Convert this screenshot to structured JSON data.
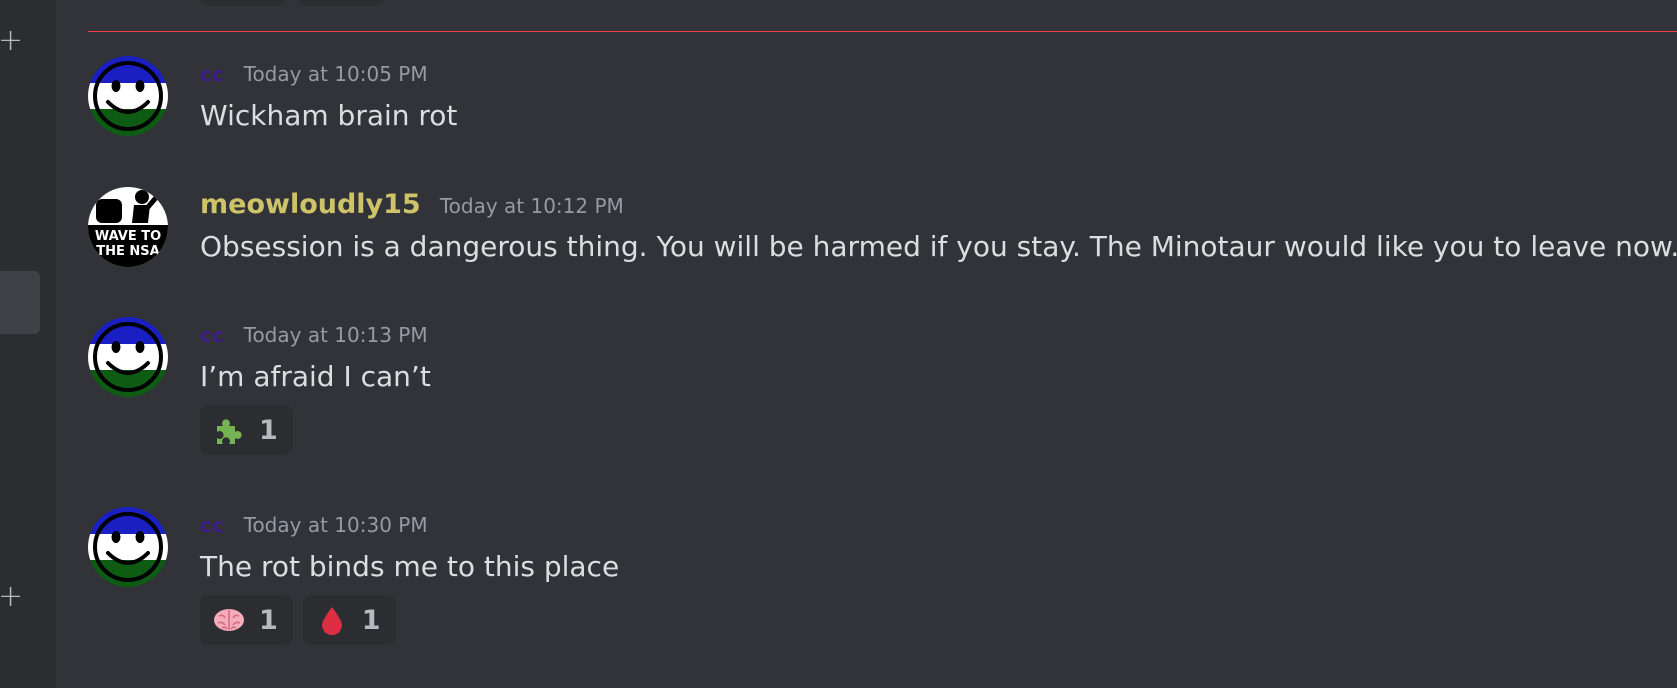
{
  "messages": [
    {
      "author": "cc",
      "timestamp": "Today at 10:05 PM",
      "content": "Wickham brain rot",
      "avatar": "smiley-avatar",
      "reactions": []
    },
    {
      "author": "meowloudly15",
      "timestamp": "Today at 10:12 PM",
      "content": "Obsession is a dangerous thing. You will be harmed if you stay. The Minotaur would like you to leave now.",
      "avatar": "wave-to-the-nsa-avatar",
      "avatar_text": [
        "WAVE TO",
        "THE NSA"
      ],
      "reactions": []
    },
    {
      "author": "cc",
      "timestamp": "Today at 10:13 PM",
      "content": "I’m afraid I can’t",
      "avatar": "smiley-avatar",
      "reactions": [
        {
          "emoji": "puzzle-piece-icon",
          "count": "1"
        }
      ]
    },
    {
      "author": "cc",
      "timestamp": "Today at 10:30 PM",
      "content": "The rot binds me to this place",
      "avatar": "smiley-avatar",
      "reactions": [
        {
          "emoji": "brain-icon",
          "count": "1"
        },
        {
          "emoji": "drop-of-blood-icon",
          "count": "1"
        }
      ]
    }
  ],
  "icons": {
    "add": "+"
  },
  "colors": {
    "background": "#313338",
    "sidebar": "#2b2d31",
    "new_messages_divider": "#f23f43",
    "cc_name": "#3d1b8a",
    "meow_name": "#cfc36a",
    "timestamp": "#949ba4",
    "text": "#dbdee1"
  }
}
